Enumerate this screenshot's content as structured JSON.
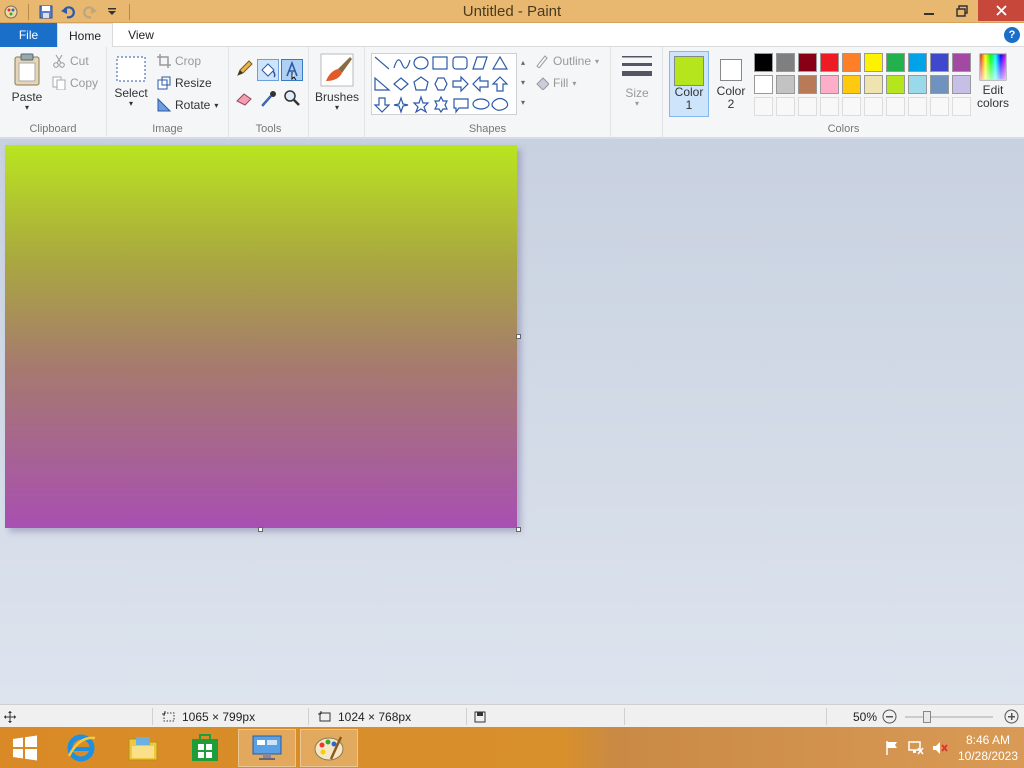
{
  "window": {
    "title": "Untitled - Paint"
  },
  "tabs": {
    "file": "File",
    "home": "Home",
    "view": "View"
  },
  "clipboard": {
    "paste": "Paste",
    "cut": "Cut",
    "copy": "Copy",
    "label": "Clipboard"
  },
  "image": {
    "select": "Select",
    "crop": "Crop",
    "resize": "Resize",
    "rotate": "Rotate",
    "label": "Image"
  },
  "tools": {
    "label": "Tools"
  },
  "brushes": {
    "label": "Brushes"
  },
  "shapes": {
    "outline": "Outline",
    "fill": "Fill",
    "label": "Shapes"
  },
  "size": {
    "label": "Size"
  },
  "colors": {
    "color1_label": "Color",
    "color1_num": "1",
    "color2_label": "Color",
    "color2_num": "2",
    "edit_label": "Edit",
    "edit_label2": "colors",
    "label": "Colors",
    "color1": "#b5e61d",
    "color2": "#ffffff",
    "palette_row1": [
      "#000000",
      "#7f7f7f",
      "#880015",
      "#ed1c24",
      "#ff7f27",
      "#fff200",
      "#22b14c",
      "#00a2e8",
      "#3f48cc",
      "#a349a4"
    ],
    "palette_row2": [
      "#ffffff",
      "#c3c3c3",
      "#b97a57",
      "#ffaec9",
      "#ffc90e",
      "#efe4b0",
      "#b5e61d",
      "#99d9ea",
      "#7092be",
      "#c8bfe7"
    ]
  },
  "status": {
    "selection_size": "1065 × 799px",
    "image_size": "1024 × 768px",
    "zoom": "50%"
  },
  "taskbar": {
    "time": "8:46 AM",
    "date": "10/28/2023"
  }
}
